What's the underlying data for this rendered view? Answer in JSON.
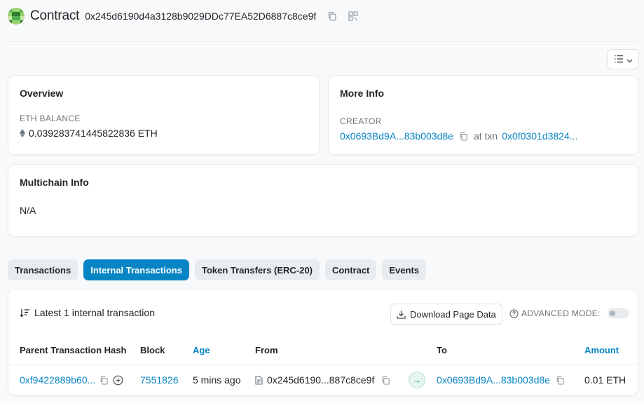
{
  "header": {
    "title": "Contract",
    "address": "0x245d6190d4a3128b9029DDc77EA52D6887c8ce9f",
    "icons": [
      "copy-icon",
      "qr-code-icon"
    ]
  },
  "filter": {
    "icon": "list-filter-icon"
  },
  "overview": {
    "title": "Overview",
    "balance_label": "ETH BALANCE",
    "balance_value": "0.039283741445822836 ETH"
  },
  "more_info": {
    "title": "More Info",
    "creator_label": "CREATOR",
    "creator_address": "0x0693Bd9A...83b003d8e",
    "at_txn": "at txn",
    "txn_hash": "0x0f0301d3824..."
  },
  "multichain": {
    "title": "Multichain Info",
    "value": "N/A"
  },
  "tabs": [
    {
      "label": "Transactions",
      "active": false
    },
    {
      "label": "Internal Transactions",
      "active": true
    },
    {
      "label": "Token Transfers (ERC-20)",
      "active": false
    },
    {
      "label": "Contract",
      "active": false
    },
    {
      "label": "Events",
      "active": false
    }
  ],
  "table": {
    "summary": "Latest 1 internal transaction",
    "download_label": "Download Page Data",
    "advanced_label": "ADVANCED MODE:",
    "columns": [
      "Parent Transaction Hash",
      "Block",
      "Age",
      "From",
      "To",
      "Amount"
    ],
    "rows": [
      {
        "parent_hash": "0xf9422889b60...",
        "block": "7551826",
        "age": "5 mins ago",
        "from": "0x245d6190...887c8ce9f",
        "direction": "→",
        "to": "0x0693Bd9A...83b003d8e",
        "amount": "0.01 ETH"
      }
    ]
  },
  "colors": {
    "accent": "#0784c3",
    "background": "#f8f9fa",
    "in_badge": "#00a186"
  }
}
